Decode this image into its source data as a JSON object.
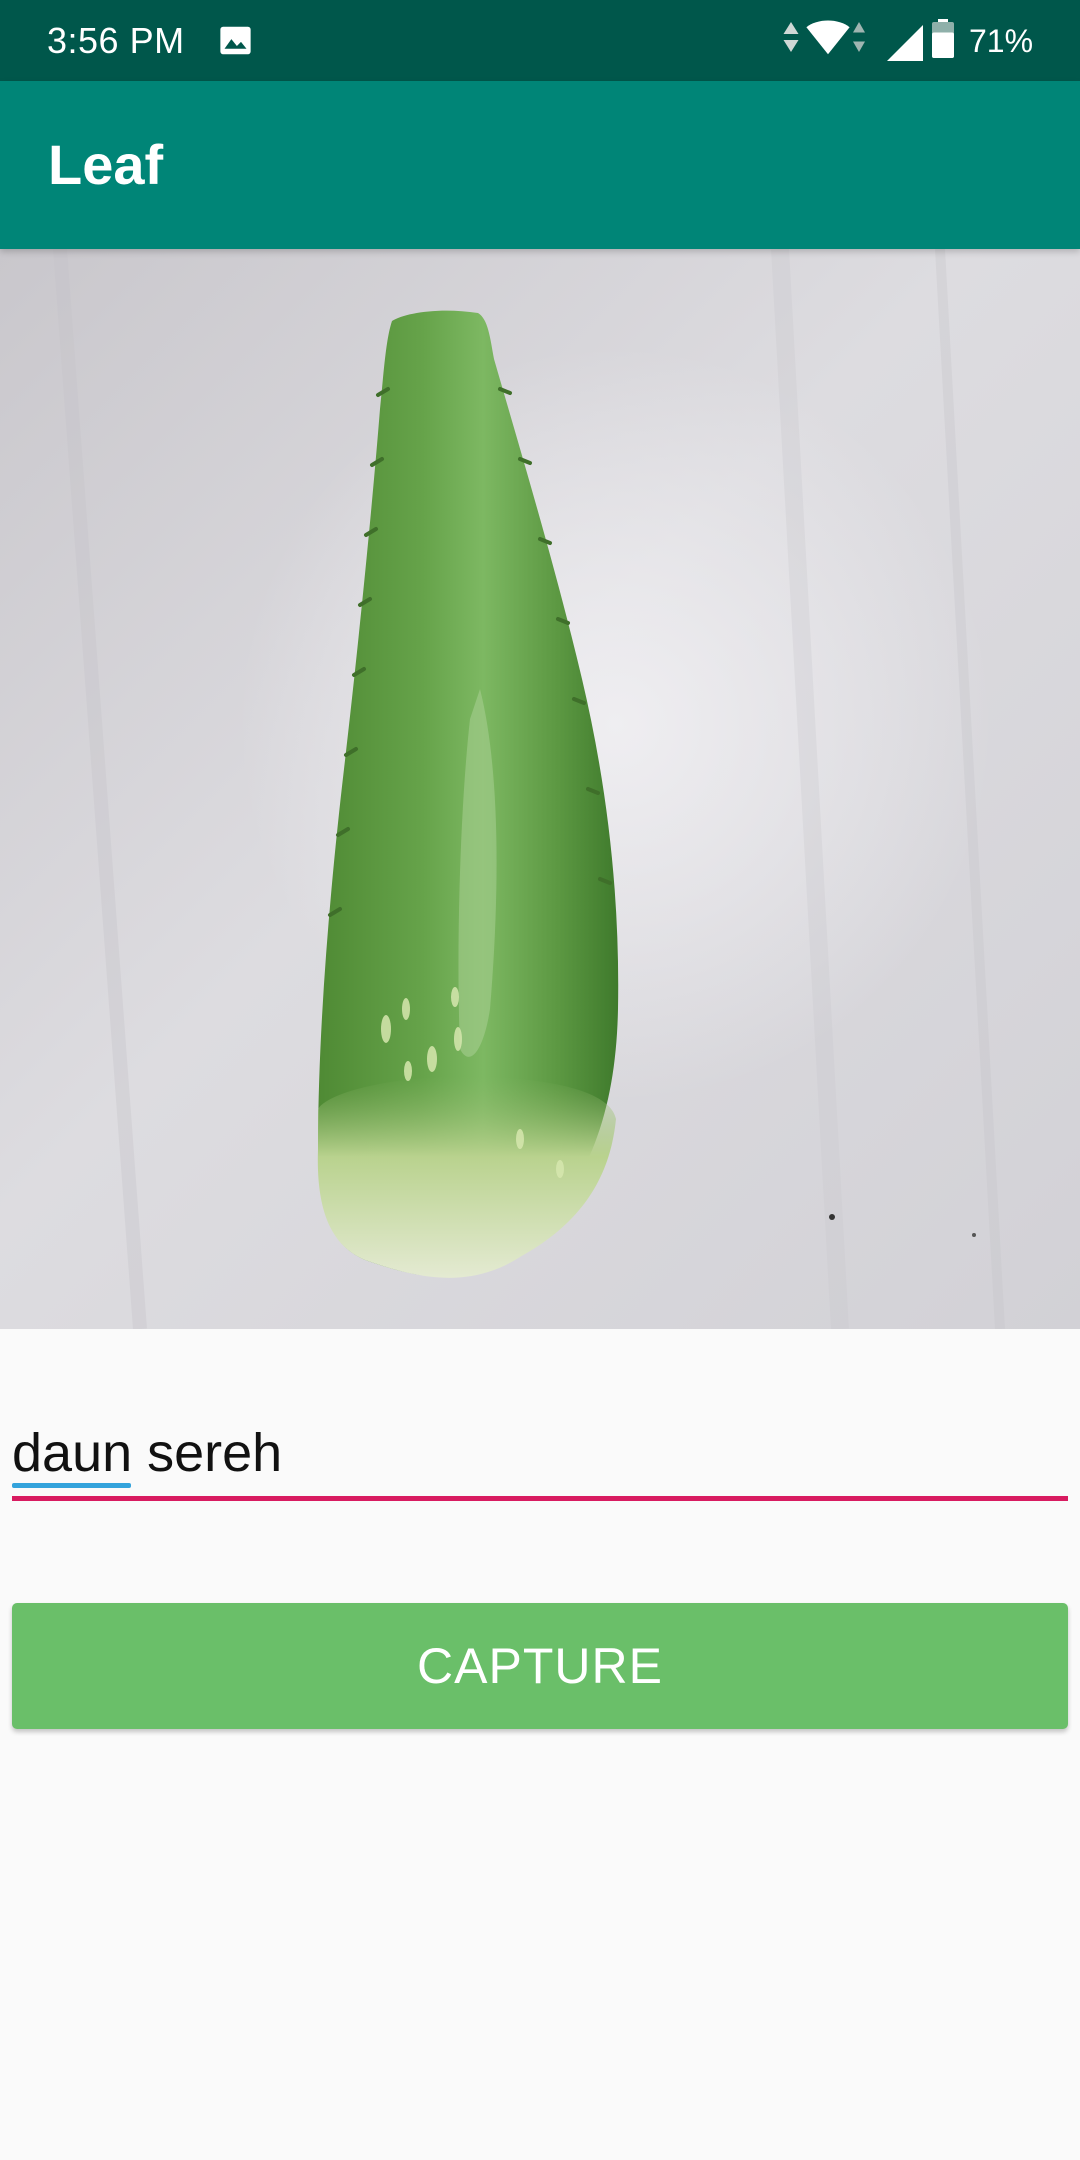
{
  "status_bar": {
    "time": "3:56 PM",
    "battery_percent": "71%",
    "battery_level": 0.71,
    "icons": [
      "image-icon",
      "data-arrows-icon",
      "wifi-icon",
      "signal-icon",
      "battery-icon"
    ]
  },
  "app_bar": {
    "title": "Leaf"
  },
  "preview": {
    "content": "photo"
  },
  "name_input": {
    "value": "daun sereh"
  },
  "capture_button": {
    "label": "CAPTURE"
  },
  "colors": {
    "status_bar": "#00574b",
    "app_bar": "#008577",
    "accent": "#d81b60",
    "button": "#6abf69",
    "background": "#fafafa"
  }
}
